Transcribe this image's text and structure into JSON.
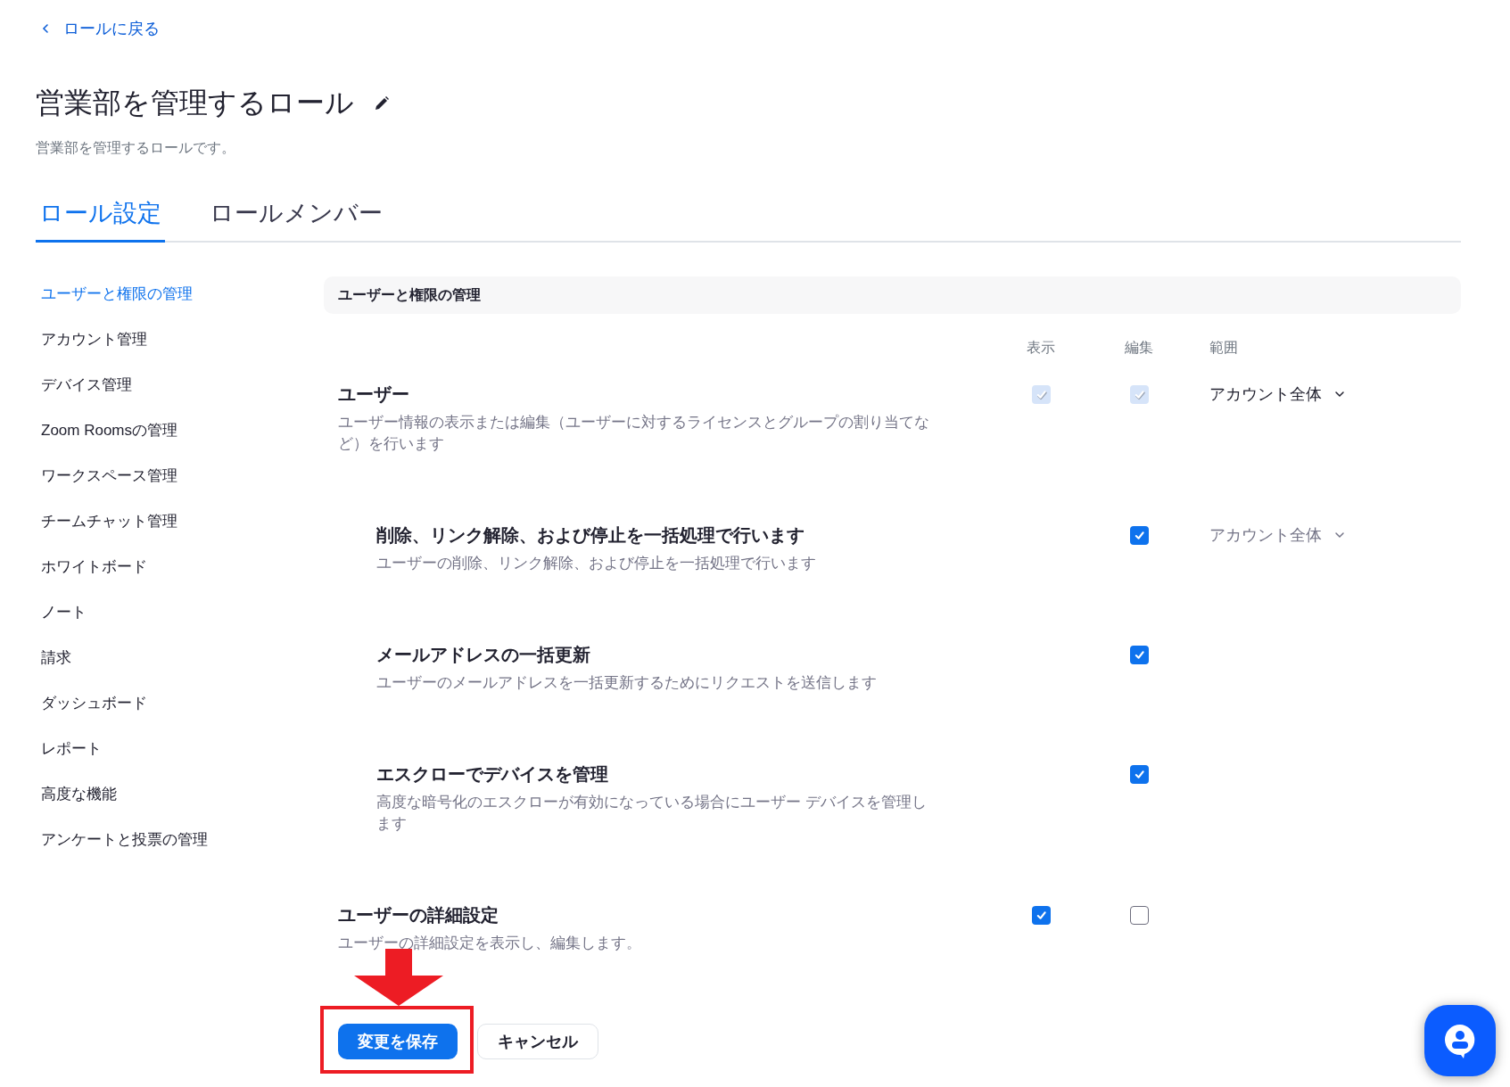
{
  "back_link": {
    "label": "ロールに戻る"
  },
  "title": "営業部を管理するロール",
  "subtitle": "営業部を管理するロールです。",
  "tabs": [
    {
      "label": "ロール設定",
      "selected": true
    },
    {
      "label": "ロールメンバー",
      "selected": false
    }
  ],
  "sidebar": {
    "items": [
      {
        "label": "ユーザーと権限の管理",
        "selected": true
      },
      {
        "label": "アカウント管理",
        "selected": false
      },
      {
        "label": "デバイス管理",
        "selected": false
      },
      {
        "label": "Zoom Roomsの管理",
        "selected": false
      },
      {
        "label": "ワークスペース管理",
        "selected": false
      },
      {
        "label": "チームチャット管理",
        "selected": false
      },
      {
        "label": "ホワイトボード",
        "selected": false
      },
      {
        "label": "ノート",
        "selected": false
      },
      {
        "label": "請求",
        "selected": false
      },
      {
        "label": "ダッシュボード",
        "selected": false
      },
      {
        "label": "レポート",
        "selected": false
      },
      {
        "label": "高度な機能",
        "selected": false
      },
      {
        "label": "アンケートと投票の管理",
        "selected": false
      }
    ]
  },
  "section": {
    "title": "ユーザーと権限の管理",
    "columns": [
      "表示",
      "編集",
      "範囲"
    ],
    "rows": [
      {
        "title": "ユーザー",
        "description": "ユーザー情報の表示または編集（ユーザーに対するライセンスとグループの割り当てなど）を行います",
        "view": {
          "checked": true,
          "disabled": true
        },
        "edit": {
          "checked": true,
          "disabled": true
        },
        "scope": {
          "label": "アカウント全体",
          "disabled": false
        },
        "children": [
          {
            "title": "削除、リンク解除、および停止を一括処理で行います",
            "description": "ユーザーの削除、リンク解除、および停止を一括処理で行います",
            "edit": {
              "checked": true,
              "disabled": false
            },
            "scope": {
              "label": "アカウント全体",
              "disabled": true
            }
          },
          {
            "title": "メールアドレスの一括更新",
            "description": "ユーザーのメールアドレスを一括更新するためにリクエストを送信します",
            "edit": {
              "checked": true,
              "disabled": false
            }
          },
          {
            "title": "エスクローでデバイスを管理",
            "description": "高度な暗号化のエスクローが有効になっている場合にユーザー デバイスを管理します",
            "edit": {
              "checked": true,
              "disabled": false
            }
          }
        ]
      },
      {
        "title": "ユーザーの詳細設定",
        "description": "ユーザーの詳細設定を表示し、編集します。",
        "view": {
          "checked": true,
          "disabled": false
        },
        "edit": {
          "checked": false,
          "disabled": false
        }
      }
    ]
  },
  "buttons": [
    {
      "label": "変更を保存",
      "kind": "primary"
    },
    {
      "label": "キャンセル",
      "kind": "secondary"
    }
  ]
}
